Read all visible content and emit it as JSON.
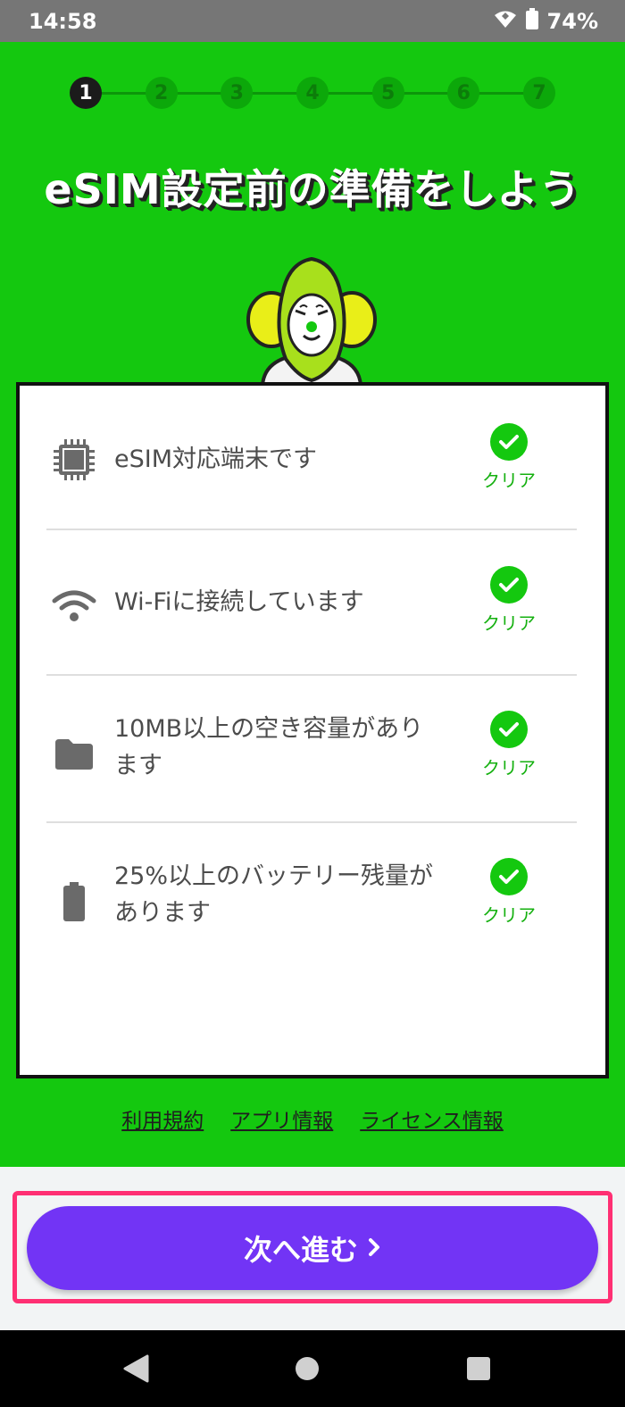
{
  "status_bar": {
    "time": "14:58",
    "battery_percent": "74%",
    "icons": [
      "wifi-icon",
      "battery-icon"
    ]
  },
  "stepper": {
    "steps": [
      "1",
      "2",
      "3",
      "4",
      "5",
      "6",
      "7"
    ],
    "current": 1
  },
  "title": "eSIM設定前の準備をしよう",
  "checklist": [
    {
      "icon": "chip-icon",
      "text": "eSIM対応端末です",
      "status": "クリア"
    },
    {
      "icon": "wifi-icon",
      "text": "Wi-Fiに接続しています",
      "status": "クリア"
    },
    {
      "icon": "folder-icon",
      "text": "10MB以上の空き容量があります",
      "status": "クリア"
    },
    {
      "icon": "battery-icon",
      "text": "25%以上のバッテリー残量があります",
      "status": "クリア"
    }
  ],
  "footer_links": [
    "利用規約",
    "アプリ情報",
    "ライセンス情報"
  ],
  "next_button": {
    "label": "次へ進む",
    "icon": "chevron-right-icon"
  },
  "nav": [
    "back-icon",
    "home-icon",
    "recents-icon"
  ],
  "colors": {
    "green": "#14c80f",
    "purple": "#7234f5",
    "highlight": "#ff2f73"
  }
}
